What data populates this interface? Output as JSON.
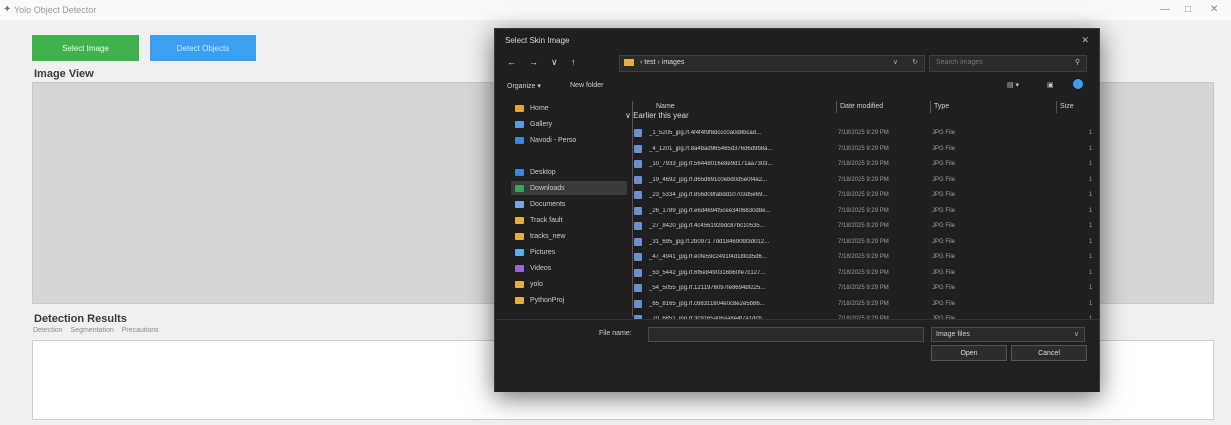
{
  "app": {
    "title": "Yolo Object Detector"
  },
  "buttons": {
    "select_image": "Select Image",
    "detect_objects": "Detect Objects"
  },
  "sections": {
    "image_view": "Image View",
    "detection_results": "Detection Results"
  },
  "result_tabs": [
    "Detection",
    "Segmentation",
    "Precautions"
  ],
  "dialog": {
    "title": "Select Skin Image",
    "breadcrumb": "‹ test › images",
    "search_placeholder": "Search images",
    "organize": "Organize ▾",
    "new_folder": "New folder",
    "sidebar": [
      {
        "label": "Home",
        "color": "#e8a040"
      },
      {
        "label": "Gallery",
        "color": "#5a9be0"
      },
      {
        "label": "Navodi - Perso",
        "color": "#3d86d6"
      },
      {
        "label": "Desktop",
        "color": "#3d86d6"
      },
      {
        "label": "Downloads",
        "color": "#38a65a",
        "selected": true
      },
      {
        "label": "Documents",
        "color": "#7aa6e0"
      },
      {
        "label": "Track fault",
        "color": "#e0b040"
      },
      {
        "label": "tracks_new",
        "color": "#e0b040"
      },
      {
        "label": "Pictures",
        "color": "#5ab0e8"
      },
      {
        "label": "Videos",
        "color": "#9a64d8"
      },
      {
        "label": "yolo",
        "color": "#e0b040"
      },
      {
        "label": "PythonProj",
        "color": "#e0b040"
      }
    ],
    "columns": {
      "name": "Name",
      "date": "Date modified",
      "type": "Type",
      "size": "Size"
    },
    "group": "Earlier this year",
    "files": [
      {
        "name": "_1_5205_jpg.rf.4f4f4f9f8dccc0a0d8bcad...",
        "date": "7/18/2025 9:29 PM",
        "type": "JPG File",
        "size": "1"
      },
      {
        "name": "_4_1201_jpg.rf.8a4bad965465d376d6d9b8a...",
        "date": "7/18/2025 9:29 PM",
        "type": "JPG File",
        "size": "1"
      },
      {
        "name": "_10_7933_jpg.rf.56448016e8e9d171aa7303...",
        "date": "7/18/2025 9:29 PM",
        "type": "JPG File",
        "size": "1"
      },
      {
        "name": "_19_4692_jpg.rf.d65d691c0ebd0d5e0f4a2...",
        "date": "7/18/2025 9:29 PM",
        "type": "JPG File",
        "size": "1"
      },
      {
        "name": "_23_5334_jpg.rf.856d08fabdd10703d5e69...",
        "date": "7/18/2025 9:29 PM",
        "type": "JPG File",
        "size": "1"
      },
      {
        "name": "_26_1789_jpg.rf.e6d4694f5cee3406830d8e...",
        "date": "7/18/2025 9:29 PM",
        "type": "JPG File",
        "size": "1"
      },
      {
        "name": "_27_8420_jpg.rf.4c456192bdc87bc10535...",
        "date": "7/18/2025 9:29 PM",
        "type": "JPG File",
        "size": "1"
      },
      {
        "name": "_31_695_jpg.rf.2b0971 7dd184690bf3d012...",
        "date": "7/18/2025 9:29 PM",
        "type": "JPG File",
        "size": "1"
      },
      {
        "name": "_47_4941_jpg.rf.e0fe59c2491f4d18fcd5d6...",
        "date": "7/18/2025 9:29 PM",
        "type": "JPG File",
        "size": "1"
      },
      {
        "name": "_53_5442_jpg.rf.6f6e8490316b60fe7c127...",
        "date": "7/18/2025 9:29 PM",
        "type": "JPG File",
        "size": "1"
      },
      {
        "name": "_54_5055_jpg.rf.1211976097fe8694bf225...",
        "date": "7/18/2025 9:29 PM",
        "type": "JPG File",
        "size": "1"
      },
      {
        "name": "_65_8165_jpg.rf.c68311804e0c8e2e5b86...",
        "date": "7/18/2025 9:29 PM",
        "type": "JPG File",
        "size": "1"
      },
      {
        "name": "_70_6851_jpg.rf.3c9165a06aa8e4f7a1dcb",
        "date": "7/18/2025 9:29 PM",
        "type": "JPG File",
        "size": "1"
      }
    ],
    "file_name_label": "File name:",
    "file_name_value": "",
    "file_type": "Image files",
    "open": "Open",
    "cancel": "Cancel"
  }
}
